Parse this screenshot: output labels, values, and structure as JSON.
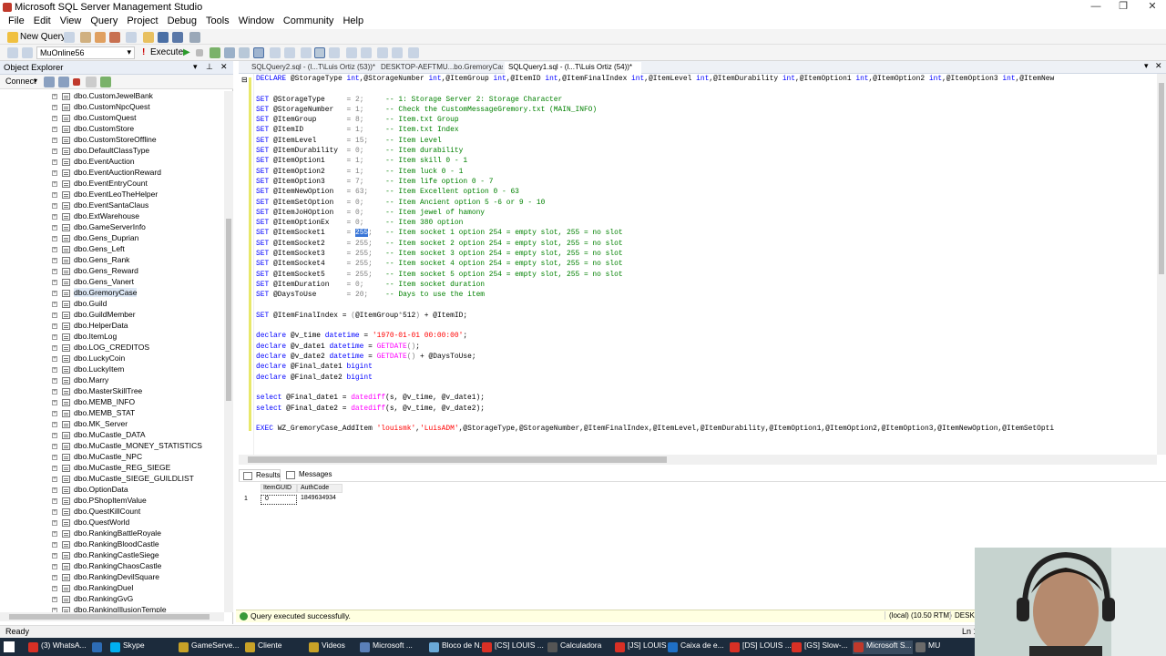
{
  "window": {
    "title": "Microsoft SQL Server Management Studio"
  },
  "menu": [
    "File",
    "Edit",
    "View",
    "Query",
    "Project",
    "Debug",
    "Tools",
    "Window",
    "Community",
    "Help"
  ],
  "toolbar": {
    "new_query": "New Query",
    "database": "MuOnline56",
    "execute": "Execute"
  },
  "object_explorer": {
    "title": "Object Explorer",
    "connect": "Connect",
    "items": [
      "dbo.CustomJewelBank",
      "dbo.CustomNpcQuest",
      "dbo.CustomQuest",
      "dbo.CustomStore",
      "dbo.CustomStoreOffline",
      "dbo.DefaultClassType",
      "dbo.EventAuction",
      "dbo.EventAuctionReward",
      "dbo.EventEntryCount",
      "dbo.EventLeoTheHelper",
      "dbo.EventSantaClaus",
      "dbo.ExtWarehouse",
      "dbo.GameServerInfo",
      "dbo.Gens_Duprian",
      "dbo.Gens_Left",
      "dbo.Gens_Rank",
      "dbo.Gens_Reward",
      "dbo.Gens_Vanert",
      "dbo.GremoryCase",
      "dbo.Guild",
      "dbo.GuildMember",
      "dbo.HelperData",
      "dbo.ItemLog",
      "dbo.LOG_CREDITOS",
      "dbo.LuckyCoin",
      "dbo.LuckyItem",
      "dbo.Marry",
      "dbo.MasterSkillTree",
      "dbo.MEMB_INFO",
      "dbo.MEMB_STAT",
      "dbo.MK_Server",
      "dbo.MuCastle_DATA",
      "dbo.MuCastle_MONEY_STATISTICS",
      "dbo.MuCastle_NPC",
      "dbo.MuCastle_REG_SIEGE",
      "dbo.MuCastle_SIEGE_GUILDLIST",
      "dbo.OptionData",
      "dbo.PShopItemValue",
      "dbo.QuestKillCount",
      "dbo.QuestWorld",
      "dbo.RankingBattleRoyale",
      "dbo.RankingBloodCastle",
      "dbo.RankingCastleSiege",
      "dbo.RankingChaosCastle",
      "dbo.RankingDevilSquare",
      "dbo.RankingDuel",
      "dbo.RankingGvG",
      "dbo.RankingIllusionTemple"
    ],
    "selected": "dbo.GremoryCase"
  },
  "tabs": [
    {
      "label": "SQLQuery2.sql - (l...T\\Luis Ortiz (53))*",
      "active": false
    },
    {
      "label": "DESKTOP-AEFTMU...bo.GremoryCase",
      "active": false
    },
    {
      "label": "SQLQuery1.sql - (l...T\\Luis Ortiz (54))*",
      "active": true
    }
  ],
  "editor": {
    "declare_line": "DECLARE @StorageType int,@StorageNumber int,@ItemGroup int,@ItemID int,@ItemFinalIndex int,@ItemLevel int,@ItemDurability int,@ItemOption1 int,@ItemOption2 int,@ItemOption3 int,@ItemNew",
    "sets": [
      {
        "var": "@StorageType",
        "val": "2;",
        "comment": "-- 1: Storage Server 2: Storage Character"
      },
      {
        "var": "@StorageNumber",
        "val": "1;",
        "comment": "-- Check the CustomMessageGremory.txt (MAIN_INFO)"
      },
      {
        "var": "@ItemGroup",
        "val": "8;",
        "comment": "-- Item.txt Group"
      },
      {
        "var": "@ItemID",
        "val": "1;",
        "comment": "-- Item.txt Index"
      },
      {
        "var": "@ItemLevel",
        "val": "15;",
        "comment": "-- Item Level"
      },
      {
        "var": "@ItemDurability",
        "val": "0;",
        "comment": "-- Item durability"
      },
      {
        "var": "@ItemOption1",
        "val": "1;",
        "comment": "-- Item skill 0 - 1"
      },
      {
        "var": "@ItemOption2",
        "val": "1;",
        "comment": "-- Item luck 0 - 1"
      },
      {
        "var": "@ItemOption3",
        "val": "7;",
        "comment": "-- Item life option 0 - 7"
      },
      {
        "var": "@ItemNewOption",
        "val": "63;",
        "comment": "-- Item Excellent option 0 - 63"
      },
      {
        "var": "@ItemSetOption",
        "val": "0;",
        "comment": "-- Item Ancient option 5 -6 or 9 - 10"
      },
      {
        "var": "@ItemJoHOption",
        "val": "0;",
        "comment": "-- Item jewel of hamony"
      },
      {
        "var": "@ItemOptionEx",
        "val": "0;",
        "comment": "-- Item 380 option"
      },
      {
        "var": "@ItemSocket1",
        "val": "255;",
        "comment": "-- Item socket 1 option 254 = empty slot, 255 = no slot",
        "selected": "255"
      },
      {
        "var": "@ItemSocket2",
        "val": "255;",
        "comment": "-- Item socket 2 option 254 = empty slot, 255 = no slot"
      },
      {
        "var": "@ItemSocket3",
        "val": "255;",
        "comment": "-- Item socket 3 option 254 = empty slot, 255 = no slot"
      },
      {
        "var": "@ItemSocket4",
        "val": "255;",
        "comment": "-- Item socket 4 option 254 = empty slot, 255 = no slot"
      },
      {
        "var": "@ItemSocket5",
        "val": "255;",
        "comment": "-- Item socket 5 option 254 = empty slot, 255 = no slot"
      },
      {
        "var": "@ItemDuration",
        "val": "0;",
        "comment": "-- Item socket duration"
      },
      {
        "var": "@DaysToUse",
        "val": "20;",
        "comment": "-- Days to use the item"
      }
    ],
    "final_index": "SET @ItemFinalIndex = (@ItemGroup*512) + @ItemID;",
    "declares": [
      "declare @v_time datetime = '1970-01-01 00:00:00';",
      "declare @v_date1 datetime = GETDATE();",
      "declare @v_date2 datetime = GETDATE() + @DaysToUse;",
      "declare @Final_date1 bigint",
      "declare @Final_date2 bigint"
    ],
    "selects": [
      "select @Final_date1 = datediff(s, @v_time, @v_date1);",
      "select @Final_date2 = datediff(s, @v_time, @v_date2);"
    ],
    "exec_line": "EXEC WZ_GremoryCase_AddItem 'louismk','LuisADM',@StorageType,@StorageNumber,@ItemFinalIndex,@ItemLevel,@ItemDurability,@ItemOption1,@ItemOption2,@ItemOption3,@ItemNewOption,@ItemSetOpti"
  },
  "results": {
    "tabs": [
      "Results",
      "Messages"
    ],
    "columns": [
      "ItemGUID",
      "AuthCode"
    ],
    "rows": [
      {
        "num": "1",
        "cells": [
          "0",
          "1849634934"
        ]
      }
    ]
  },
  "status": {
    "message": "Query executed successfully.",
    "server": "(local) (10.50 RTM)",
    "db": "DESKTO",
    "ready": "Ready",
    "line": "Ln 1"
  },
  "taskbar": [
    {
      "label": "(3) WhatsA...",
      "color": "#d93025"
    },
    {
      "label": "",
      "color": "#2d6cb5"
    },
    {
      "label": "Skype",
      "color": "#00aff0"
    },
    {
      "label": "GameServe...",
      "color": "#c9a227"
    },
    {
      "label": "Cliente",
      "color": "#c9a227"
    },
    {
      "label": "Videos",
      "color": "#c9a227"
    },
    {
      "label": "Microsoft ...",
      "color": "#5a7fb8"
    },
    {
      "label": "Bloco de N...",
      "color": "#6aa9d8"
    },
    {
      "label": "[CS] LOUIS ...",
      "color": "#d93025"
    },
    {
      "label": "Calculadora",
      "color": "#555"
    },
    {
      "label": "[JS] LOUIS ...",
      "color": "#d93025"
    },
    {
      "label": "Caixa de e...",
      "color": "#1f6fc5"
    },
    {
      "label": "[DS] LOUIS ...",
      "color": "#d93025"
    },
    {
      "label": "[GS] Slow-...",
      "color": "#d93025"
    },
    {
      "label": "Microsoft S...",
      "color": "#c0392b"
    },
    {
      "label": "MU",
      "color": "#6a6a6a"
    }
  ]
}
